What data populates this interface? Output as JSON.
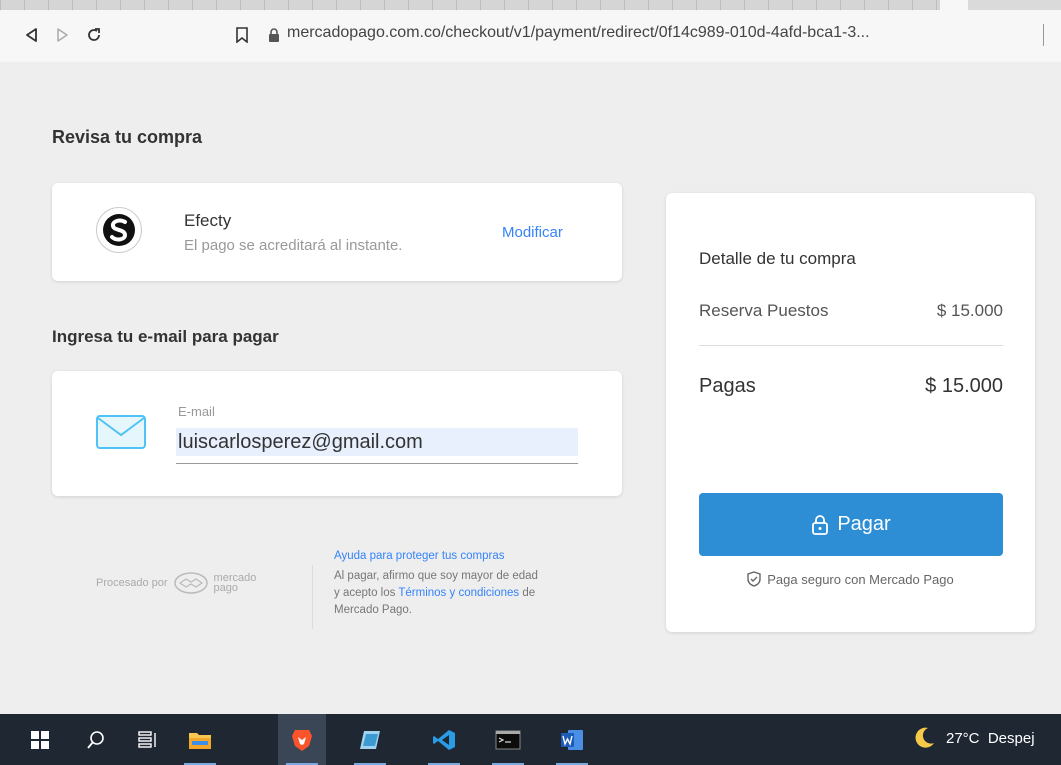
{
  "browser": {
    "url": "mercadopago.com.co/checkout/v1/payment/redirect/0f14c989-010d-4afd-bca1-3..."
  },
  "page": {
    "review_title": "Revisa tu compra",
    "payment_method": {
      "name": "Efecty",
      "description": "El pago se acreditará al instante.",
      "modify_label": "Modificar"
    },
    "email_section": {
      "title": "Ingresa tu e-mail para pagar",
      "label": "E-mail",
      "value": "luiscarlosperez@gmail.com"
    },
    "footer": {
      "processed_by": "Procesado por",
      "brand_line1": "mercado",
      "brand_line2": "pago",
      "help_link": "Ayuda para proteger tus compras",
      "terms_prefix": "Al pagar, afirmo que soy mayor de edad",
      "terms_mid": "y acepto los",
      "terms_link": "Términos y condiciones",
      "terms_suffix": "de",
      "terms_end": "Mercado Pago."
    }
  },
  "summary": {
    "title": "Detalle de tu compra",
    "item_label": "Reserva Puestos",
    "item_price": "$ 15.000",
    "total_label": "Pagas",
    "total_price": "$ 15.000",
    "pay_button": "Pagar",
    "secure_text": "Paga seguro con Mercado Pago"
  },
  "taskbar": {
    "weather": "27°C  Despej"
  },
  "colors": {
    "accent": "#3483fa",
    "button": "#2d8ed6",
    "background": "#eeeeee",
    "taskbar": "#1f2733"
  }
}
